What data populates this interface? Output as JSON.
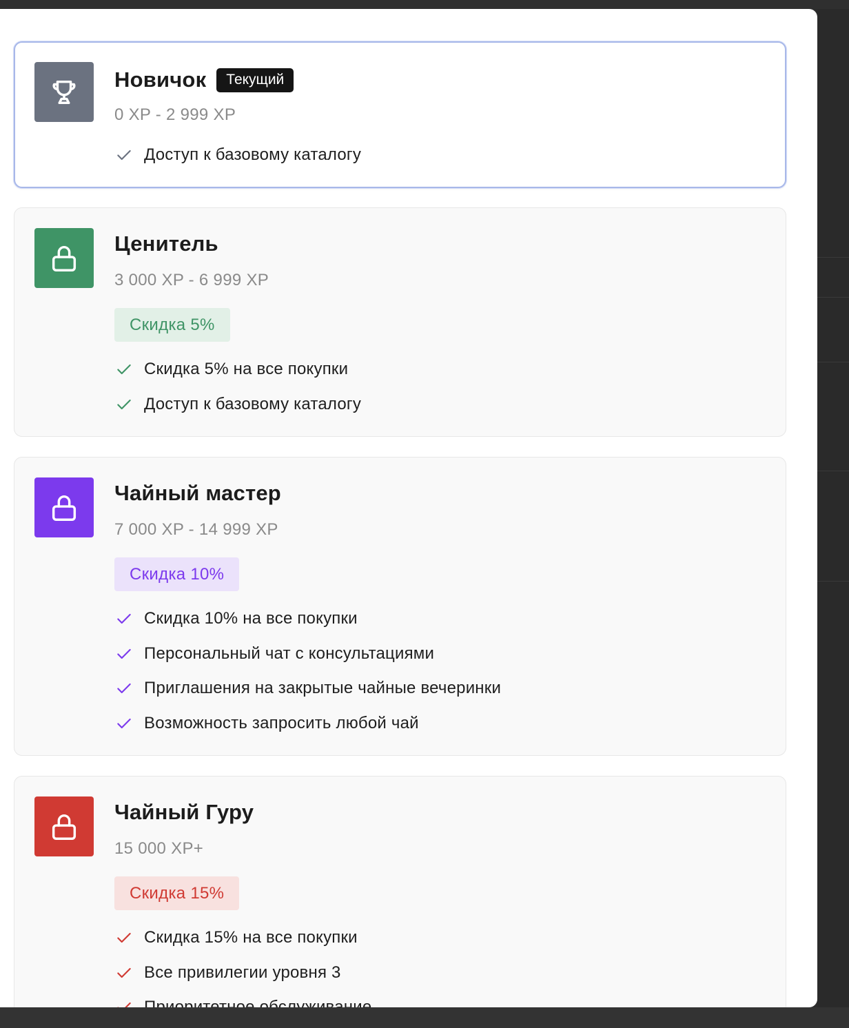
{
  "colors": {
    "novice": "#6b7280",
    "connoisseur": "#3f9466",
    "master": "#7c3aed",
    "guru": "#d03a33"
  },
  "levels": [
    {
      "name": "Новичок",
      "badge": "Текущий",
      "range": "0 XP - 2 999 XP",
      "icon": "trophy-icon",
      "accent": "#6b7280",
      "discount": null,
      "features": [
        "Доступ к базовому каталогу"
      ]
    },
    {
      "name": "Ценитель",
      "range": "3 000 XP - 6 999 XP",
      "icon": "lock-icon",
      "accent": "#3f9466",
      "discount": "Скидка 5%",
      "features": [
        "Скидка 5% на все покупки",
        "Доступ к базовому каталогу"
      ]
    },
    {
      "name": "Чайный мастер",
      "range": "7 000 XP - 14 999 XP",
      "icon": "lock-icon",
      "accent": "#7c3aed",
      "discount": "Скидка 10%",
      "features": [
        "Скидка 10% на все покупки",
        "Персональный чат с консультациями",
        "Приглашения на закрытые чайные вечеринки",
        "Возможность запросить любой чай"
      ]
    },
    {
      "name": "Чайный Гуру",
      "range": "15 000 XP+",
      "icon": "lock-icon",
      "accent": "#d03a33",
      "discount": "Скидка 15%",
      "features": [
        "Скидка 15% на все покупки",
        "Все привилегии уровня 3",
        "Приоритетное обслуживание"
      ]
    }
  ]
}
